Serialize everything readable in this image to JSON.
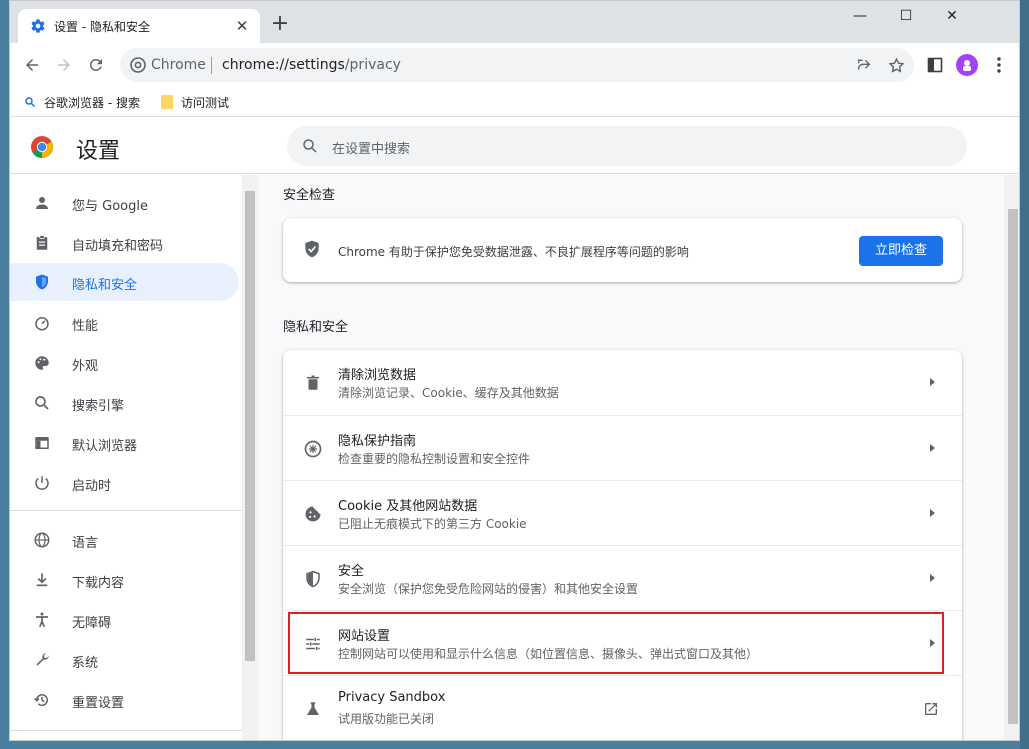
{
  "tab": {
    "title": "设置 - 隐私和安全",
    "close": "✕",
    "new_tab": "+"
  },
  "window_controls": {
    "minimize": "—",
    "maximize": "☐",
    "close": "✕"
  },
  "omnibox": {
    "site": "Chrome",
    "url_host": "chrome://settings",
    "url_path": "/privacy"
  },
  "bookmarks": [
    {
      "label": "谷歌浏览器 - 搜索",
      "icon": "search-icon"
    },
    {
      "label": "访问测试",
      "icon": "folder-icon"
    }
  ],
  "settings": {
    "title": "设置",
    "search_placeholder": "在设置中搜索"
  },
  "sidebar": {
    "items": [
      {
        "label": "您与 Google",
        "icon": "person-icon",
        "active": false
      },
      {
        "label": "自动填充和密码",
        "icon": "clipboard-icon",
        "active": false
      },
      {
        "label": "隐私和安全",
        "icon": "shield-icon",
        "active": true
      },
      {
        "label": "性能",
        "icon": "speedometer-icon",
        "active": false
      },
      {
        "label": "外观",
        "icon": "palette-icon",
        "active": false
      },
      {
        "label": "搜索引擎",
        "icon": "search-icon",
        "active": false
      },
      {
        "label": "默认浏览器",
        "icon": "browser-icon",
        "active": false
      },
      {
        "label": "启动时",
        "icon": "power-icon",
        "active": false
      },
      {
        "label": "语言",
        "icon": "globe-icon",
        "active": false
      },
      {
        "label": "下载内容",
        "icon": "download-icon",
        "active": false
      },
      {
        "label": "无障碍",
        "icon": "accessibility-icon",
        "active": false
      },
      {
        "label": "系统",
        "icon": "wrench-icon",
        "active": false
      },
      {
        "label": "重置设置",
        "icon": "history-icon",
        "active": false
      }
    ]
  },
  "safety_check": {
    "heading": "安全检查",
    "text": "Chrome 有助于保护您免受数据泄露、不良扩展程序等问题的影响",
    "button": "立即检查"
  },
  "privacy": {
    "heading": "隐私和安全",
    "rows": [
      {
        "title": "清除浏览数据",
        "subtitle": "清除浏览记录、Cookie、缓存及其他数据",
        "icon": "trash-icon"
      },
      {
        "title": "隐私保护指南",
        "subtitle": "检查重要的隐私控制设置和安全控件",
        "icon": "compass-icon"
      },
      {
        "title": "Cookie 及其他网站数据",
        "subtitle": "已阻止无痕模式下的第三方 Cookie",
        "icon": "cookie-icon"
      },
      {
        "title": "安全",
        "subtitle": "安全浏览（保护您免受危险网站的侵害）和其他安全设置",
        "icon": "shield-half-icon"
      },
      {
        "title": "网站设置",
        "subtitle": "控制网站可以使用和显示什么信息（如位置信息、摄像头、弹出式窗口及其他）",
        "icon": "sliders-icon"
      },
      {
        "title": "Privacy Sandbox",
        "subtitle": "试用版功能已关闭",
        "icon": "flask-icon"
      }
    ]
  },
  "colors": {
    "accent": "#1a73e8",
    "highlight_box": "#e31c25",
    "active_bg": "#e8f0fe"
  }
}
